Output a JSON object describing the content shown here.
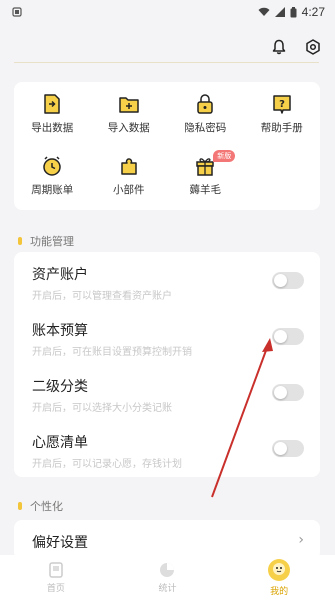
{
  "status": {
    "time": "4:27"
  },
  "tools": [
    {
      "label": "导出数据",
      "icon": "export-data-icon"
    },
    {
      "label": "导入数据",
      "icon": "import-data-icon"
    },
    {
      "label": "隐私密码",
      "icon": "privacy-lock-icon"
    },
    {
      "label": "帮助手册",
      "icon": "help-manual-icon"
    },
    {
      "label": "周期账单",
      "icon": "periodic-bill-icon"
    },
    {
      "label": "小部件",
      "icon": "widget-icon"
    },
    {
      "label": "薅羊毛",
      "icon": "gift-icon",
      "badge": "新版"
    }
  ],
  "sections": {
    "features": "功能管理",
    "personalize": "个性化"
  },
  "features": [
    {
      "title": "资产账户",
      "desc": "开启后，可以管理查看资产账户",
      "enabled": false
    },
    {
      "title": "账本预算",
      "desc": "开启后，可在账目设置预算控制开销",
      "enabled": false
    },
    {
      "title": "二级分类",
      "desc": "开启后，可以选择大小分类记账",
      "enabled": false
    },
    {
      "title": "心愿清单",
      "desc": "开启后，可以记录心愿，存钱计划",
      "enabled": false
    }
  ],
  "preferences": {
    "title": "偏好设置"
  },
  "nav": [
    {
      "label": "首页",
      "icon": "home-icon"
    },
    {
      "label": "统计",
      "icon": "stats-icon"
    },
    {
      "label": "我的",
      "icon": "profile-icon",
      "active": true
    }
  ],
  "colors": {
    "accent": "#f3c53a",
    "toggle_off": "#e2e2e2",
    "arrow": "#c9302c"
  }
}
